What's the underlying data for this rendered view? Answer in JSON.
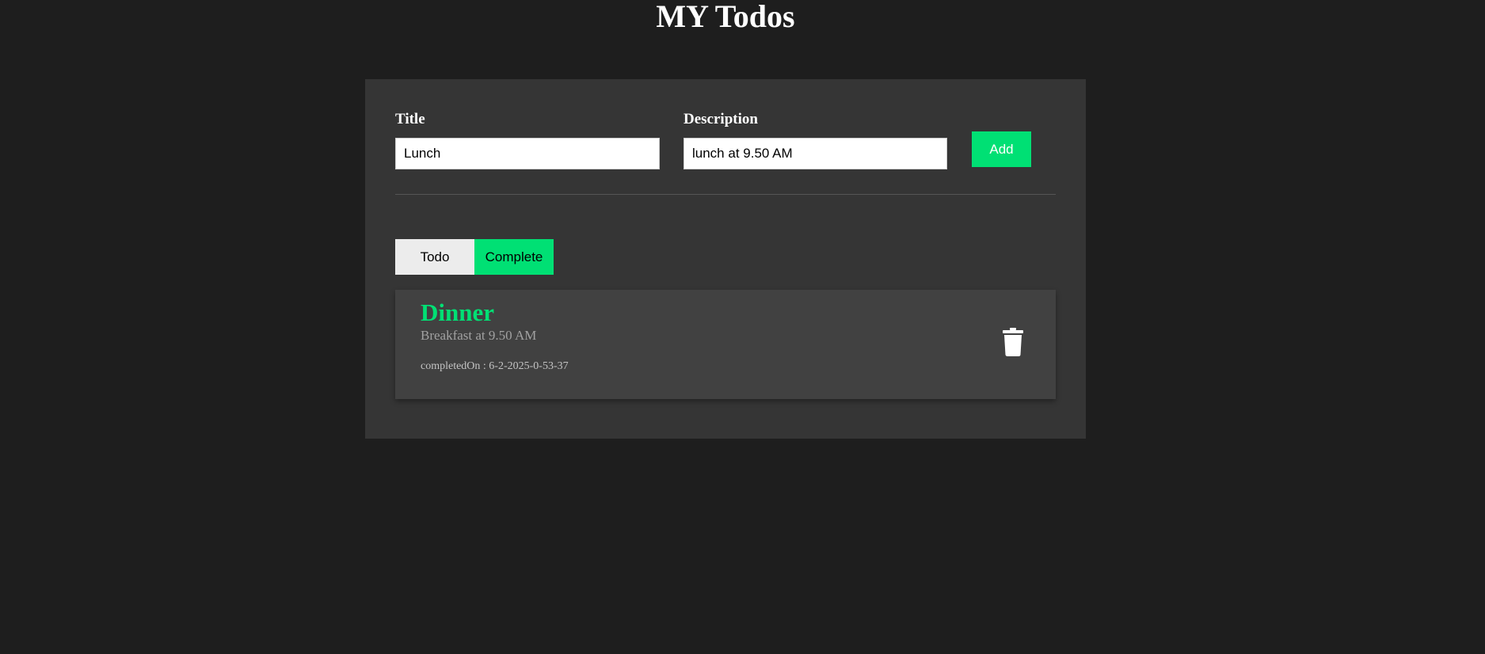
{
  "app": {
    "title": "MY Todos"
  },
  "form": {
    "title_label": "Title",
    "title_value": "Lunch",
    "description_label": "Description",
    "description_value": "lunch at 9.50 AM",
    "add_label": "Add"
  },
  "tabs": {
    "todo_label": "Todo",
    "complete_label": "Complete",
    "active": "Complete"
  },
  "items": [
    {
      "title": "Dinner",
      "description": "Breakfast at 9.50 AM",
      "completed_on": "completedOn : 6-2-2025-0-53-37",
      "icon": "trash-icon"
    }
  ],
  "colors": {
    "background": "#1e1e1e",
    "card": "#353535",
    "item": "#414141",
    "accent": "#00e074"
  }
}
